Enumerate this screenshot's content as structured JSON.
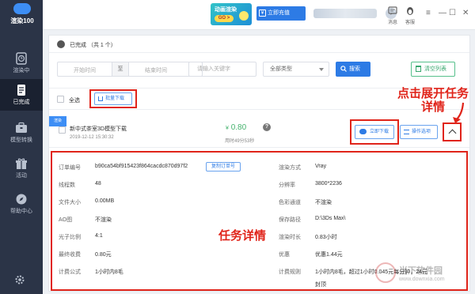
{
  "app": {
    "logo_text": "渲染100"
  },
  "sidebar": {
    "items": [
      {
        "label": "渲染中",
        "icon": "clock-icon"
      },
      {
        "label": "已完成",
        "icon": "document-icon"
      },
      {
        "label": "模型转换",
        "icon": "briefcase-icon"
      },
      {
        "label": "活动",
        "icon": "gift-icon"
      },
      {
        "label": "帮助中心",
        "icon": "compass-icon"
      }
    ],
    "settings_icon": "gear-icon"
  },
  "topbar": {
    "promo_title": "动画渲染",
    "promo_cta": "GO >",
    "recharge_label": "立即充值",
    "messages_label": "消息",
    "service_label": "客服"
  },
  "panel": {
    "title": "已完成 （共 1 个）",
    "filter": {
      "start_placeholder": "开始时间",
      "separator": "至",
      "end_placeholder": "结束时间",
      "keyword_placeholder": "请输入关键字",
      "type_value": "全部类型",
      "search_label": "搜索",
      "clear_label": "清空列表"
    },
    "select_all_label": "全选",
    "batch_download_label": "批量下载"
  },
  "task": {
    "badge": "渲染",
    "name": "新中式茶室3D模型下载",
    "time": "2019-12-12 15:30:32",
    "price_symbol": "¥",
    "price": "0.80",
    "duration": "用时49分53秒",
    "help": "?",
    "download_label": "立即下载",
    "options_label": "操作选项"
  },
  "details": {
    "rows": [
      {
        "label": "订单编号",
        "value": "b90ca54bf915423f864cacdc870d97f2",
        "label2": "渲染方式",
        "value2": "Vray"
      },
      {
        "label": "线程数",
        "value": "48",
        "label2": "分辨率",
        "value2": "3800*2236"
      },
      {
        "label": "文件大小",
        "value": "0.00MB",
        "label2": "色彩通道",
        "value2": "不渲染"
      },
      {
        "label": "AO图",
        "value": "不渲染",
        "label2": "保存路径",
        "value2": "D:\\3Ds Max\\"
      },
      {
        "label": "光子比例",
        "value": "4:1",
        "label2": "渲染时长",
        "value2": "0.83小时"
      },
      {
        "label": "最终收费",
        "value": "0.80元",
        "label2": "优惠",
        "value2": "优惠1.44元"
      },
      {
        "label": "计费公式",
        "value": "1小时内8毛",
        "label2": "计费规则",
        "value2": "1小时内8毛，超过1小时0.045元每分钟，24元"
      }
    ],
    "cap_label": "封顶",
    "copy_label": "复制订单号"
  },
  "annotations": {
    "expand_hint": "点击展开任务详情",
    "details_hint": "任务详情"
  },
  "watermark": {
    "title": "当下软件园",
    "url": "www.downxia.com"
  },
  "colors": {
    "sidebar_bg": "#2b3447",
    "accent": "#2d7be5",
    "price_green": "#46b36e",
    "annotation_red": "#e0241a"
  }
}
